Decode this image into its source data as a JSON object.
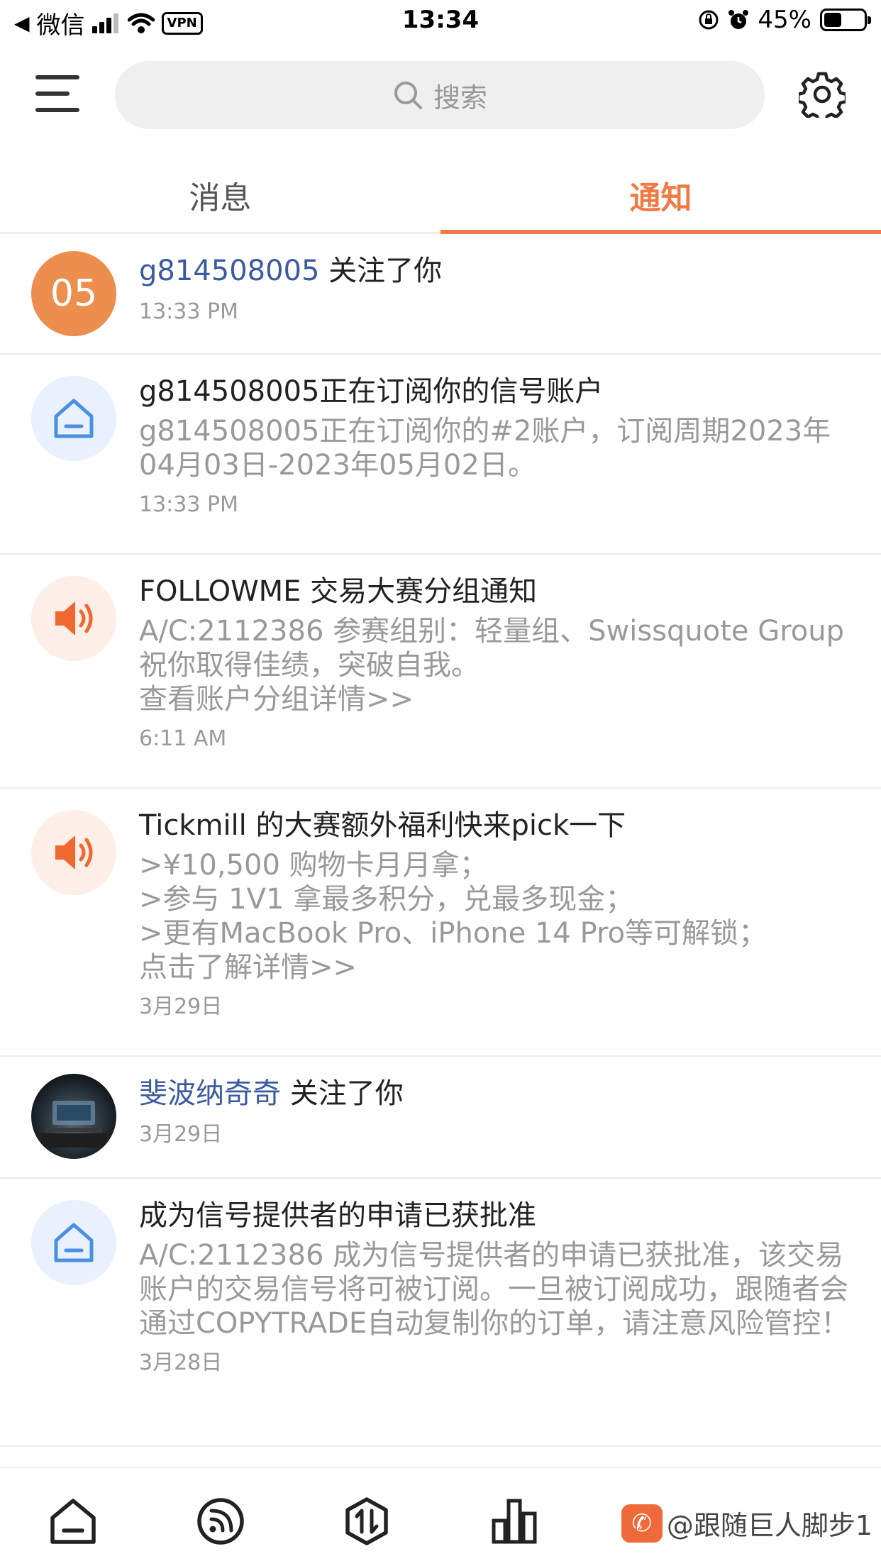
{
  "status_bar": {
    "back_app": "微信",
    "vpn": "VPN",
    "time": "13:34",
    "battery": "45%"
  },
  "header": {
    "search_placeholder": "搜索"
  },
  "tabs": [
    {
      "label": "消息",
      "active": false
    },
    {
      "label": "通知",
      "active": true
    }
  ],
  "notifications": [
    {
      "avatar_type": "number",
      "avatar_text": "05",
      "user": "g814508005",
      "action": " 关注了你",
      "time": "13:33 PM"
    },
    {
      "avatar_type": "home",
      "title": "g814508005正在订阅你的信号账户",
      "body": [
        "g814508005正在订阅你的#2账户，订阅周期2023年04月03日-2023年05月02日。"
      ],
      "time": "13:33 PM"
    },
    {
      "avatar_type": "speaker",
      "title": "FOLLOWME 交易大赛分组通知",
      "body": [
        "A/C:2112386 参赛组别：轻量组、Swissquote Group",
        "祝你取得佳绩，突破自我。",
        "查看账户分组详情>>"
      ],
      "time": "6:11 AM"
    },
    {
      "avatar_type": "speaker",
      "title": "Tickmill 的大赛额外福利快来pick一下",
      "body": [
        ">¥10,500 购物卡月月拿；",
        ">参与 1V1 拿最多积分，兑最多现金；",
        ">更有MacBook Pro、iPhone 14 Pro等可解锁；",
        "点击了解详情>>"
      ],
      "time": "3月29日"
    },
    {
      "avatar_type": "photo",
      "user": "斐波纳奇奇",
      "action": " 关注了你",
      "time": "3月29日"
    },
    {
      "avatar_type": "home",
      "title": "成为信号提供者的申请已获批准",
      "body": [
        "A/C:2112386 成为信号提供者的申请已获批准，该交易账户的交易信号将可被订阅。一旦被订阅成功，跟随者会通过COPYTRADE自动复制你的订单，请注意风险管控！"
      ],
      "time": "3月28日"
    }
  ],
  "watermark": {
    "text": "@跟随巨人脚步1"
  },
  "colors": {
    "accent": "#f07a43",
    "user_link": "#3b5aa0",
    "muted": "#999999"
  }
}
